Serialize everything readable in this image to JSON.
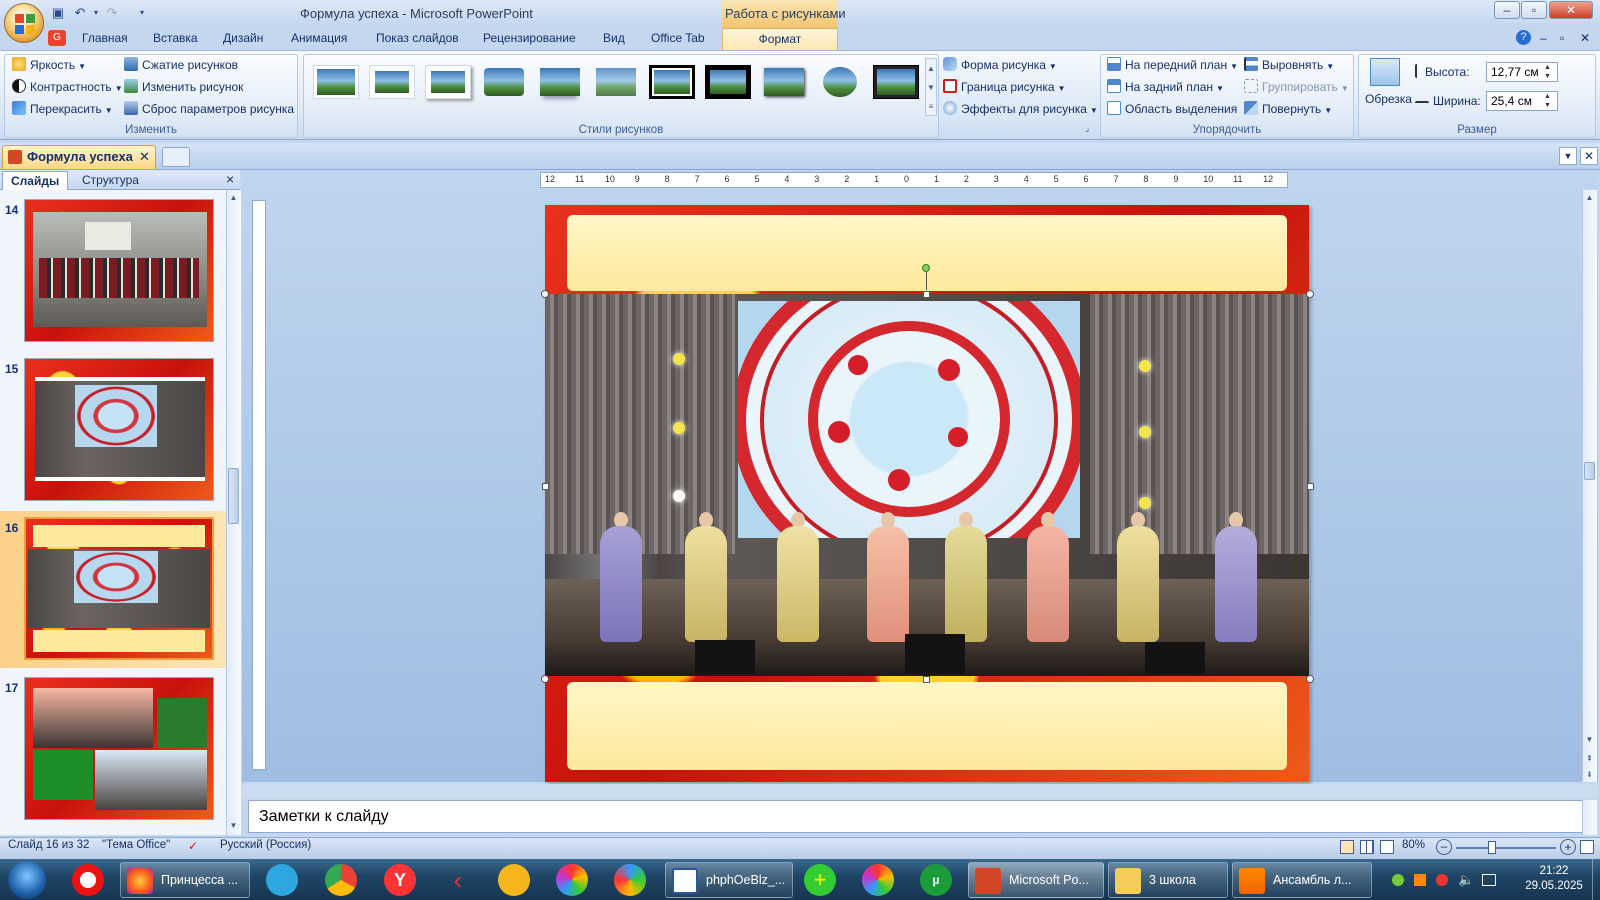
{
  "window": {
    "title": "Формула успеха - Microsoft PowerPoint",
    "context_tab_group": "Работа с рисунками",
    "controls": {
      "minimize": "–",
      "maximize": "▫",
      "close": "✕"
    }
  },
  "quick_access": [
    {
      "icon": "save-icon",
      "glyph": "💾"
    },
    {
      "icon": "undo-icon",
      "glyph": "↶"
    },
    {
      "icon": "redo-icon",
      "glyph": "↷"
    },
    {
      "icon": "customize-icon",
      "glyph": "▾"
    }
  ],
  "ribbon_tabs": [
    "Главная",
    "Вставка",
    "Дизайн",
    "Анимация",
    "Показ слайдов",
    "Рецензирование",
    "Вид",
    "Office Tab",
    "Формат"
  ],
  "active_tab": "Формат",
  "ribbon": {
    "adjust": {
      "label": "Изменить",
      "brightness": "Яркость",
      "contrast": "Контрастность",
      "recolor": "Перекрасить",
      "compress": "Сжатие рисунков",
      "change": "Изменить рисунок",
      "reset": "Сброс параметров рисунка"
    },
    "styles": {
      "label": "Стили рисунков",
      "count": 11
    },
    "shape": {
      "picture_shape": "Форма рисунка",
      "picture_border": "Граница рисунка",
      "picture_effects": "Эффекты для рисунка"
    },
    "arrange": {
      "label": "Упорядочить",
      "bring_front": "На передний план",
      "send_back": "На задний план",
      "selection_pane": "Область выделения",
      "align": "Выровнять",
      "group": "Группировать",
      "rotate": "Повернуть"
    },
    "size": {
      "label": "Размер",
      "crop": "Обрезка",
      "height_label": "Высота:",
      "height_value": "12,77 см",
      "width_label": "Ширина:",
      "width_value": "25,4 см"
    }
  },
  "document_tab": {
    "label": "Формула успеха",
    "close": "✕"
  },
  "left_pane": {
    "tabs": [
      "Слайды",
      "Структура"
    ],
    "close": "×",
    "slides": [
      {
        "number": "14"
      },
      {
        "number": "15"
      },
      {
        "number": "16",
        "selected": true
      },
      {
        "number": "17"
      }
    ]
  },
  "ruler": {
    "labels": [
      "12",
      "11",
      "10",
      "9",
      "8",
      "7",
      "6",
      "5",
      "4",
      "3",
      "2",
      "1",
      "0",
      "1",
      "2",
      "3",
      "4",
      "5",
      "6",
      "7",
      "8",
      "9",
      "10",
      "11",
      "12"
    ]
  },
  "notes": {
    "placeholder": "Заметки к слайду"
  },
  "statusbar": {
    "slide": "Слайд 16 из 32",
    "theme": "\"Тема Office\"",
    "language": "Русский (Россия)",
    "zoom": "80%"
  },
  "taskbar": {
    "buttons": [
      {
        "label": "Принцесса ..."
      },
      {
        "label": "phphOeBlz_..."
      },
      {
        "label": "Microsoft Po..."
      },
      {
        "label": "3 школа"
      },
      {
        "label": "Ансамбль л..."
      }
    ],
    "time": "21:22",
    "date": "29.05.2025"
  },
  "colors": {
    "accent": "#f3c46f",
    "frame_red": "#d4170f",
    "frame_yellow": "#ffcc22",
    "cream": "#fff1b0",
    "taskbar": "#1f4566"
  }
}
